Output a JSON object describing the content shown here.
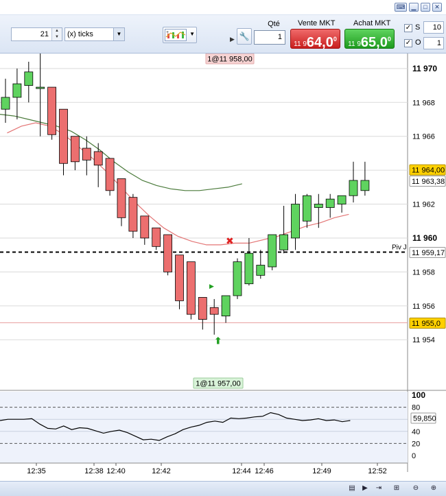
{
  "toolbar": {
    "ticks_value": "21",
    "ticks_unit": "(x) ticks",
    "qty_label": "Qté",
    "qty_value": "1",
    "sell_label": "Vente MKT",
    "buy_label": "Achat MKT",
    "sell_price": {
      "prefix": "11 9",
      "main": "64,0",
      "sup": "0"
    },
    "buy_price": {
      "prefix": "11 9",
      "main": "65,0",
      "sup": "0"
    },
    "stop": {
      "label": "S",
      "value": "10",
      "checked": true
    },
    "objective": {
      "label": "O",
      "value": "1",
      "checked": true
    }
  },
  "colors": {
    "bull": "#5fd35f",
    "bear": "#ec6f6f",
    "ma_fast": "#e37474",
    "ma_slow": "#4a7a3a",
    "osc_line": "#000000"
  },
  "chart_data": [
    {
      "type": "candlestick",
      "yaxis_ticks": [
        "11 970",
        "11 968",
        "11 966",
        "11 964",
        "11 962",
        "11 960",
        "11 958",
        "11 956",
        "11 954"
      ],
      "xaxis_ticks": [
        "12:35",
        "12:38",
        "12:40",
        "12:42",
        "12:44",
        "12:46",
        "12:49",
        "12:52"
      ],
      "ylim": [
        11953.2,
        11972.1
      ],
      "candles": [
        {
          "o": 11967.6,
          "h": 11969.4,
          "l": 11966.8,
          "c": 11968.3
        },
        {
          "o": 11968.3,
          "h": 11970.0,
          "l": 11967.0,
          "c": 11969.1
        },
        {
          "o": 11969.0,
          "h": 11970.4,
          "l": 11968.0,
          "c": 11969.8
        },
        {
          "o": 11968.9,
          "h": 11971.0,
          "l": 11966.0,
          "c": 11968.9
        },
        {
          "o": 11968.9,
          "h": 11968.9,
          "l": 11965.8,
          "c": 11966.1
        },
        {
          "o": 11967.6,
          "h": 11967.6,
          "l": 11963.7,
          "c": 11964.4
        },
        {
          "o": 11966.0,
          "h": 11966.0,
          "l": 11964.0,
          "c": 11964.5
        },
        {
          "o": 11965.3,
          "h": 11966.0,
          "l": 11963.7,
          "c": 11964.6
        },
        {
          "o": 11965.1,
          "h": 11965.6,
          "l": 11963.0,
          "c": 11964.3
        },
        {
          "o": 11964.7,
          "h": 11964.7,
          "l": 11962.5,
          "c": 11962.8
        },
        {
          "o": 11963.5,
          "h": 11963.5,
          "l": 11960.7,
          "c": 11961.2
        },
        {
          "o": 11962.4,
          "h": 11962.6,
          "l": 11960.0,
          "c": 11960.4
        },
        {
          "o": 11961.3,
          "h": 11961.3,
          "l": 11959.6,
          "c": 11960.0
        },
        {
          "o": 11960.6,
          "h": 11960.6,
          "l": 11959.3,
          "c": 11959.5
        },
        {
          "o": 11960.2,
          "h": 11960.2,
          "l": 11957.8,
          "c": 11958.0
        },
        {
          "o": 11959.0,
          "h": 11959.0,
          "l": 11955.8,
          "c": 11956.3
        },
        {
          "o": 11958.6,
          "h": 11958.6,
          "l": 11955.2,
          "c": 11955.5
        },
        {
          "o": 11956.5,
          "h": 11956.5,
          "l": 11954.6,
          "c": 11955.2
        },
        {
          "o": 11955.9,
          "h": 11956.4,
          "l": 11954.3,
          "c": 11955.5
        },
        {
          "o": 11955.4,
          "h": 11956.0,
          "l": 11955.0,
          "c": 11956.6
        },
        {
          "o": 11956.6,
          "h": 11958.8,
          "l": 11956.4,
          "c": 11958.6
        },
        {
          "o": 11957.3,
          "h": 11960.0,
          "l": 11957.2,
          "c": 11959.1
        },
        {
          "o": 11957.8,
          "h": 11959.3,
          "l": 11957.6,
          "c": 11958.4
        },
        {
          "o": 11958.3,
          "h": 11959.6,
          "l": 11958.1,
          "c": 11960.2
        },
        {
          "o": 11959.3,
          "h": 11961.9,
          "l": 11959.1,
          "c": 11960.2
        },
        {
          "o": 11960.0,
          "h": 11962.6,
          "l": 11959.3,
          "c": 11962.0
        },
        {
          "o": 11961.0,
          "h": 11962.6,
          "l": 11960.6,
          "c": 11962.5
        },
        {
          "o": 11961.8,
          "h": 11962.6,
          "l": 11960.6,
          "c": 11962.0
        },
        {
          "o": 11961.8,
          "h": 11962.6,
          "l": 11961.2,
          "c": 11962.3
        },
        {
          "o": 11962.0,
          "h": 11962.4,
          "l": 11961.5,
          "c": 11962.5
        },
        {
          "o": 11962.5,
          "h": 11964.5,
          "l": 11962.1,
          "c": 11963.4
        },
        {
          "o": 11962.8,
          "h": 11964.5,
          "l": 11962.5,
          "c": 11963.4
        }
      ],
      "ma_fast": [
        11966.2,
        11966.6,
        11966.8,
        11966.6,
        11966.1,
        11965.4,
        11964.7,
        11963.9,
        11963.0,
        11962.1,
        11961.3,
        11960.6,
        11960.1,
        11959.8,
        11959.6,
        11959.6,
        11959.7,
        11959.7,
        11959.9,
        11960.1,
        11960.4,
        11960.7,
        11960.9,
        11961.2,
        11961.4
      ],
      "ma_slow": [
        11967.3,
        11967.2,
        11967.0,
        11966.8,
        11966.6,
        11966.3,
        11965.8,
        11965.2,
        11964.5,
        11963.9,
        11963.4,
        11963.1,
        11962.9,
        11962.8,
        11962.8,
        11962.9,
        11963.0,
        11963.2
      ],
      "lines": {
        "resistance_value": "11 964,00",
        "last_value": "11 963,38",
        "pivot_label": "Piv J",
        "pivot_value": "11 959,17",
        "support_value": "11 955,0"
      },
      "annotations": {
        "top_order": "1@11 958,00",
        "bottom_order": "1@11 957,00"
      }
    },
    {
      "type": "line",
      "yaxis_ticks": [
        "100",
        "80",
        "60",
        "40",
        "20",
        "0"
      ],
      "ylim": [
        0,
        100
      ],
      "last_value": "59,850",
      "values": [
        58,
        60,
        60,
        60,
        61,
        52,
        45,
        44,
        49,
        43,
        46,
        45,
        41,
        37,
        40,
        42,
        38,
        32,
        26,
        27,
        25,
        31,
        36,
        43,
        47,
        50,
        55,
        57,
        55,
        62,
        61,
        62,
        64,
        65,
        71,
        68,
        62,
        60,
        58,
        59,
        61,
        58,
        59,
        56,
        58
      ]
    }
  ]
}
